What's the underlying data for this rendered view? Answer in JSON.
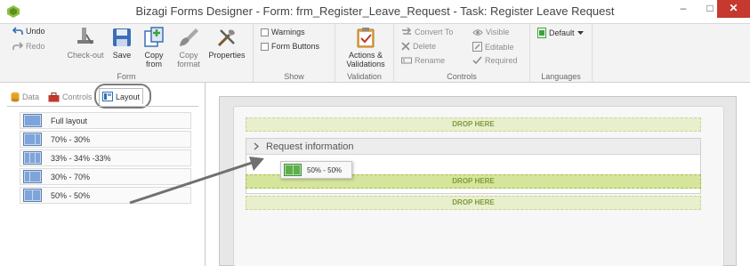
{
  "window": {
    "title": "Bizagi Forms Designer  -  Form: frm_Register_Leave_Request - Task: Register Leave Request",
    "minimize": "‒",
    "maximize": "□",
    "close": "✕"
  },
  "ribbon": {
    "undo": "Undo",
    "redo": "Redo",
    "form": {
      "group_label": "Form",
      "checkout": "Check-out",
      "save": "Save",
      "copy_from_1": "Copy",
      "copy_from_2": "from",
      "copy_format_1": "Copy",
      "copy_format_2": "format",
      "properties": "Properties"
    },
    "show": {
      "group_label": "Show",
      "warnings": "Warnings",
      "form_buttons": "Form Buttons"
    },
    "validation": {
      "group_label": "Validation",
      "actions_1": "Actions &",
      "actions_2": "Validations"
    },
    "controls": {
      "group_label": "Controls",
      "convert_to": "Convert To",
      "delete": "Delete",
      "rename": "Rename",
      "visible": "Visible",
      "editable": "Editable",
      "required": "Required"
    },
    "languages": {
      "group_label": "Languages",
      "default": "Default"
    }
  },
  "left_panel": {
    "tabs": [
      "Data",
      "Controls",
      "Layout"
    ],
    "active_tab": "Layout",
    "layouts": [
      "Full layout",
      "70% - 30%",
      "33% - 34% -33%",
      "30% - 70%",
      "50% - 50%"
    ]
  },
  "canvas": {
    "drop_here": "DROP HERE",
    "group_title": "Request information",
    "drag_item": "50% - 50%"
  },
  "colors": {
    "drop_zone": "#e8efcd",
    "drop_zone_active": "#d5e59b",
    "drop_text": "#7f9b3b",
    "close_button": "#c7382e"
  }
}
